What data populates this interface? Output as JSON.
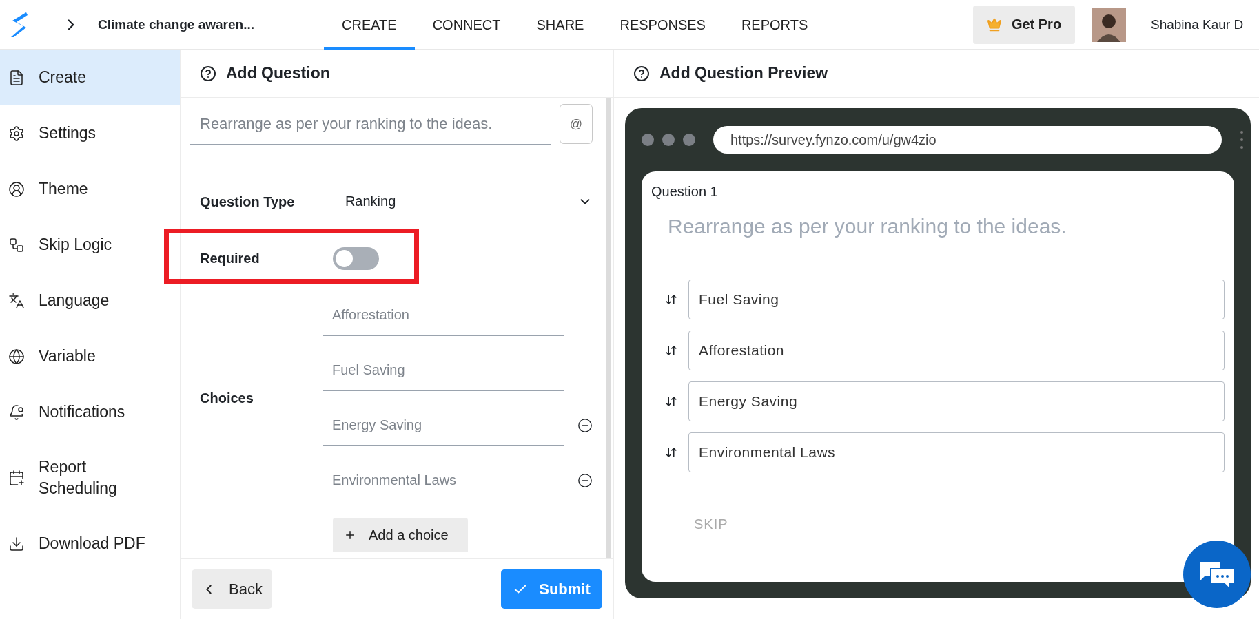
{
  "header": {
    "survey_title": "Climate change awaren...",
    "tabs": [
      {
        "label": "CREATE",
        "selected": true
      },
      {
        "label": "CONNECT",
        "selected": false
      },
      {
        "label": "SHARE",
        "selected": false
      },
      {
        "label": "RESPONSES",
        "selected": false
      },
      {
        "label": "REPORTS",
        "selected": false
      }
    ],
    "pro_button": "Get Pro",
    "user_name": "Shabina Kaur D"
  },
  "sidebar": {
    "items": [
      {
        "label": "Create",
        "kind": "create",
        "selected": true
      },
      {
        "label": "Settings",
        "kind": "settings",
        "selected": false
      },
      {
        "label": "Theme",
        "kind": "theme",
        "selected": false
      },
      {
        "label": "Skip Logic",
        "kind": "logic",
        "selected": false
      },
      {
        "label": "Language",
        "kind": "language",
        "selected": false
      },
      {
        "label": "Variable",
        "kind": "variable",
        "selected": false
      },
      {
        "label": "Notifications",
        "kind": "notifications",
        "selected": false
      },
      {
        "label": "Report Scheduling",
        "kind": "schedule",
        "selected": false
      },
      {
        "label": "Download PDF",
        "kind": "download",
        "selected": false
      }
    ]
  },
  "editor": {
    "title": "Add Question",
    "question_placeholder": "Rearrange as per your ranking to the ideas.",
    "mention_button": "@",
    "question_type_label": "Question Type",
    "question_type": "Ranking",
    "required_label": "Required",
    "required": false,
    "choices_label": "Choices",
    "choices": [
      {
        "placeholder": "Afforestation",
        "removable": false,
        "focused": false
      },
      {
        "placeholder": "Fuel Saving",
        "removable": false,
        "focused": false
      },
      {
        "placeholder": "Energy Saving",
        "removable": true,
        "focused": false
      },
      {
        "placeholder": "Environmental Laws",
        "removable": true,
        "focused": true
      }
    ],
    "add_choice": "Add a choice",
    "back_button": "Back",
    "submit_button": "Submit"
  },
  "preview": {
    "title": "Add Question Preview",
    "url": "https://survey.fynzo.com/u/gw4zio",
    "question_number": "Question 1",
    "question_text": "Rearrange as per your ranking to the ideas.",
    "ranking": [
      "Fuel Saving",
      "Afforestation",
      "Energy Saving",
      "Environmental Laws"
    ],
    "skip": "SKIP"
  }
}
